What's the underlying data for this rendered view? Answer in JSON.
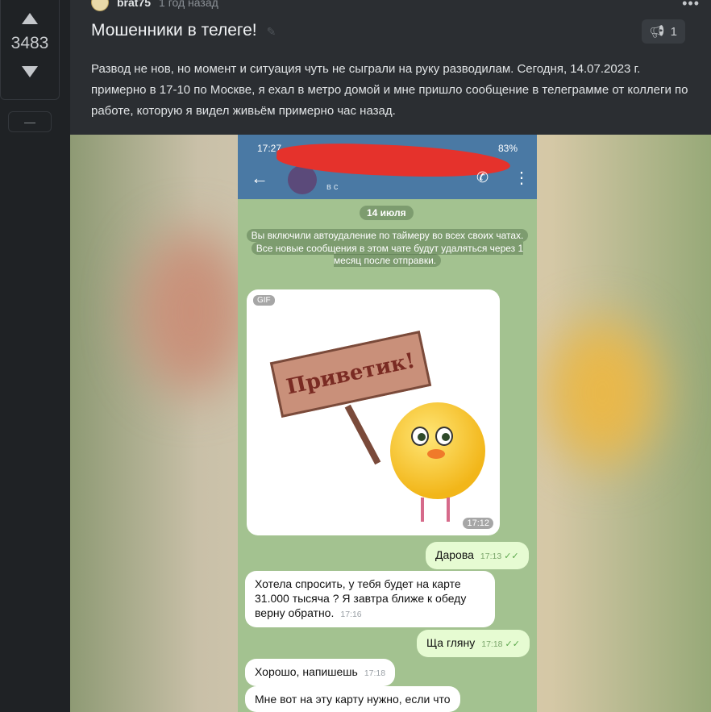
{
  "rating": {
    "value": "3483",
    "minus_label": "—"
  },
  "post": {
    "author": "brat75",
    "time": "1 год назад",
    "title": "Мошенники в телеге!",
    "comments_count": "1",
    "body": "Развод не нов, но момент и ситуация чуть не сыграли на руку разводилам. Сегодня, 14.07.2023 г. примерно в 17-10 по Москве, я ехал в метро домой и мне пришло сообщение в телеграмме от коллеги по работе, которую я видел живьём примерно час назад."
  },
  "phone": {
    "status_time": "17:27",
    "battery": "83%",
    "chat_subtitle": "в с",
    "avatar_badge": "1м",
    "date": "14 июля",
    "service_line1": "Вы включили автоудаление по таймеру во всех своих чатах.",
    "service_line2": "Все новые сообщения в этом чате будут удаляться через 1 месяц после отправки.",
    "gif_label": "GIF",
    "gif_time": "17:12",
    "gif_sign": "Приветик!",
    "messages": [
      {
        "text": "Дарова",
        "time": "17:13",
        "out": true
      },
      {
        "text": "Хотела спросить, у тебя  будет на карте 31.000 тысяча ? Я завтра ближе к обеду верну обратно.",
        "time": "17:16",
        "out": false
      },
      {
        "text": "Ща гляну",
        "time": "17:18",
        "out": true
      },
      {
        "text": "Хорошо, напишешь",
        "time": "17:18",
        "out": false
      },
      {
        "text": "Мне вот на эту карту нужно, если что",
        "time": "",
        "out": false
      }
    ]
  },
  "colors": {
    "background": "#1f2225",
    "post_bg": "#2b2e32",
    "telegram_header": "#4a79a4"
  }
}
